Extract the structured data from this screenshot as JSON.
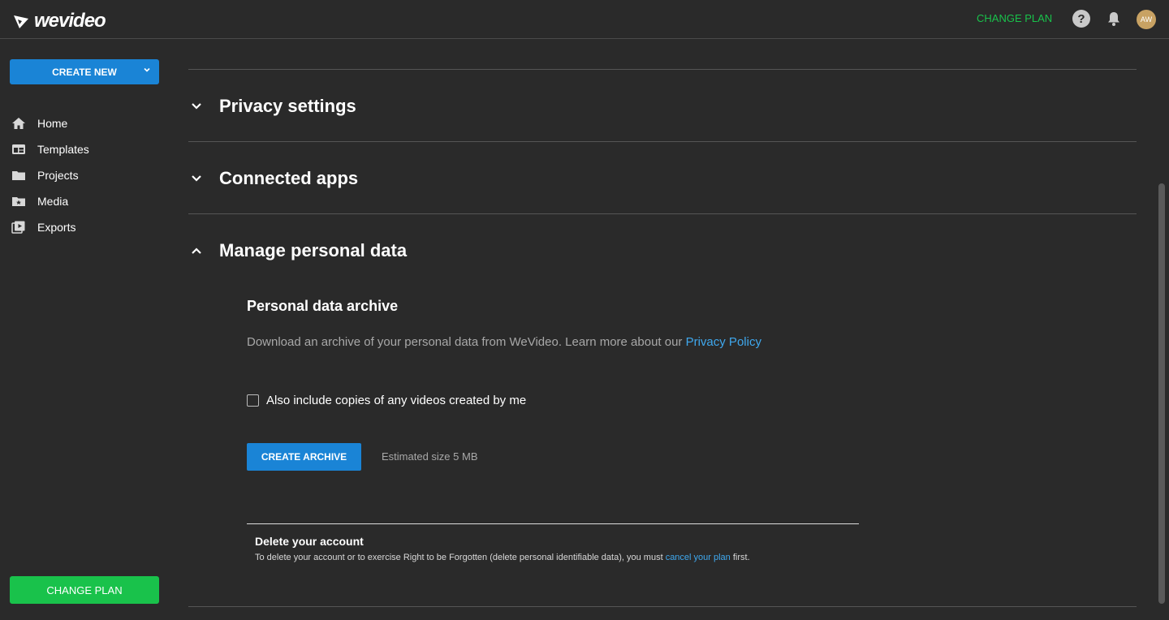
{
  "header": {
    "logo_text": "wevideo",
    "change_plan": "CHANGE PLAN",
    "help_icon": "?",
    "avatar_initials": "AW"
  },
  "sidebar": {
    "create_new": "CREATE NEW",
    "items": [
      {
        "label": "Home",
        "icon": "home-icon"
      },
      {
        "label": "Templates",
        "icon": "templates-icon"
      },
      {
        "label": "Projects",
        "icon": "folder-icon"
      },
      {
        "label": "Media",
        "icon": "media-folder-icon"
      },
      {
        "label": "Exports",
        "icon": "exports-icon"
      }
    ],
    "change_plan": "CHANGE PLAN"
  },
  "main": {
    "sections": [
      {
        "title": "Privacy settings",
        "expanded": false
      },
      {
        "title": "Connected apps",
        "expanded": false
      },
      {
        "title": "Manage personal data",
        "expanded": true
      }
    ],
    "personal_data": {
      "title": "Personal data archive",
      "description": "Download an archive of your personal data from WeVideo. Learn more about our ",
      "privacy_link": "Privacy Policy",
      "checkbox_label": "Also include copies of any videos created by me",
      "checkbox_checked": false,
      "create_archive": "CREATE ARCHIVE",
      "estimated_size": "Estimated size 5 MB"
    },
    "delete_account": {
      "title": "Delete your account",
      "description": "To delete your account or to exercise Right to be Forgotten (delete personal identifiable data), you must ",
      "link": "cancel your plan",
      "suffix": " first."
    }
  },
  "colors": {
    "background": "#2a2a2a",
    "accent_blue": "#1a84d6",
    "accent_green": "#19c24b",
    "link_blue": "#3fa8ee"
  }
}
